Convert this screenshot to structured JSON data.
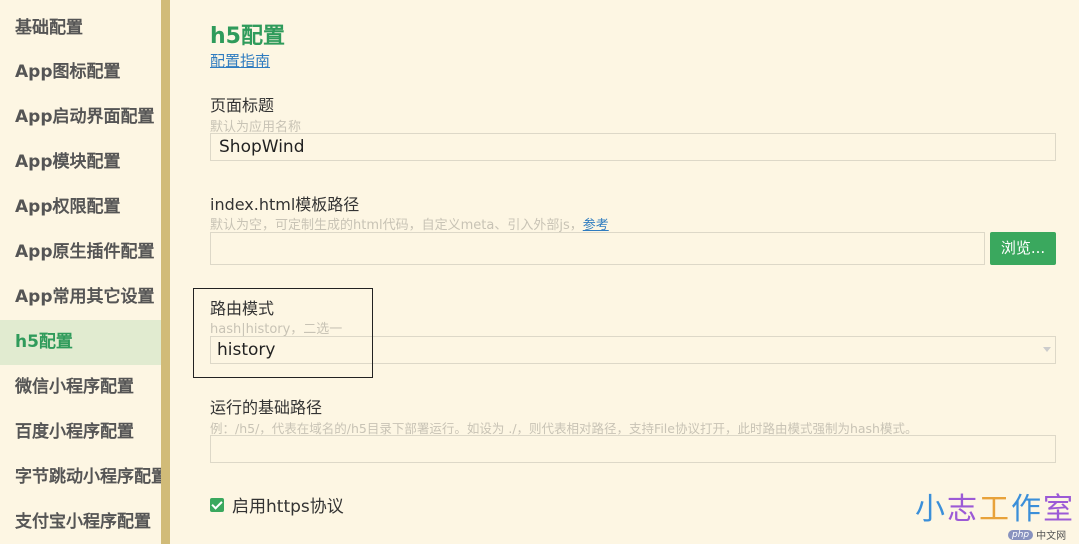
{
  "sidebar": {
    "items": [
      {
        "label": "基础配置"
      },
      {
        "label": "App图标配置"
      },
      {
        "label": "App启动界面配置"
      },
      {
        "label": "App模块配置"
      },
      {
        "label": "App权限配置"
      },
      {
        "label": "App原生插件配置"
      },
      {
        "label": "App常用其它设置"
      },
      {
        "label": "h5配置"
      },
      {
        "label": "微信小程序配置"
      },
      {
        "label": "百度小程序配置"
      },
      {
        "label": "字节跳动小程序配置"
      },
      {
        "label": "支付宝小程序配置"
      }
    ],
    "active_index": 7
  },
  "main": {
    "title": "h5配置",
    "guide_link": "配置指南",
    "page_title_field": {
      "label": "页面标题",
      "hint": "默认为应用名称",
      "value": "ShopWind"
    },
    "template_field": {
      "label": "index.html模板路径",
      "hint": "默认为空，可定制生成的html代码，自定义meta、引入外部js，",
      "hint_link": "参考",
      "value": "",
      "browse_label": "浏览..."
    },
    "router_field": {
      "label": "路由模式",
      "hint": "hash|history，二选一",
      "value": "history"
    },
    "base_path_field": {
      "label": "运行的基础路径",
      "hint": "例：/h5/，代表在域名的/h5目录下部署运行。如设为 ./，则代表相对路径，支持File协议打开，此时路由模式强制为hash模式。",
      "value": ""
    },
    "https_checkbox": {
      "label": "启用https协议",
      "checked": true
    }
  },
  "watermark": {
    "chars": [
      "小",
      "志",
      "工",
      "作",
      "室"
    ],
    "php_logo": "php",
    "site": "中文网"
  }
}
